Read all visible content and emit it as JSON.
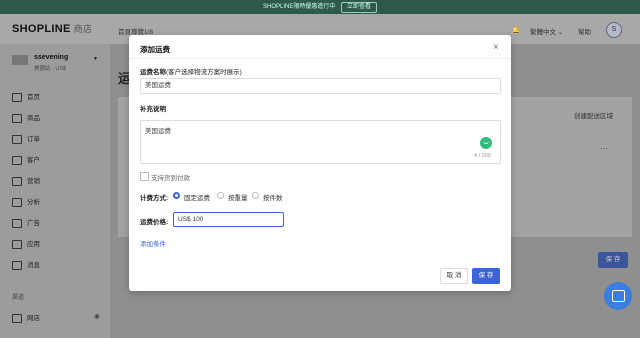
{
  "banner": {
    "text": "SHOPLINE限時優惠進行中",
    "button": "立即查看"
  },
  "header": {
    "logo": "SHOPLINE",
    "logo_sub": "商店",
    "nav_tab": "首頁導覽1/8",
    "lang": "繁體中文 ⌄",
    "help": "幫助",
    "avatar": "S"
  },
  "sidebar": {
    "store_name": "ssevening",
    "store_sub": "美國站 · US$",
    "items": [
      "首页",
      "商品",
      "订单",
      "客户",
      "营销",
      "分析",
      "广告",
      "应用",
      "消息"
    ],
    "section": "渠道",
    "channel_item": "网店"
  },
  "background": {
    "page_title": "运",
    "create_link": "创建配送区域",
    "save": "保 存"
  },
  "modal": {
    "title": "添加运费",
    "name_label": "运费名称",
    "name_hint": "(客户选择物流方案时展示)",
    "name_value": "美国运费",
    "desc_label": "补充说明",
    "desc_value": "美国运费",
    "counter": "4 / 300",
    "cod_label": "支持货到付款",
    "method_label": "计费方式:",
    "methods": [
      "固定运费",
      "按重量",
      "按件数"
    ],
    "method_selected": "固定运费",
    "price_label": "运费价格:",
    "price_value": "US$ 100",
    "add_condition": "添加条件",
    "cancel": "取 消",
    "save": "保 存"
  }
}
